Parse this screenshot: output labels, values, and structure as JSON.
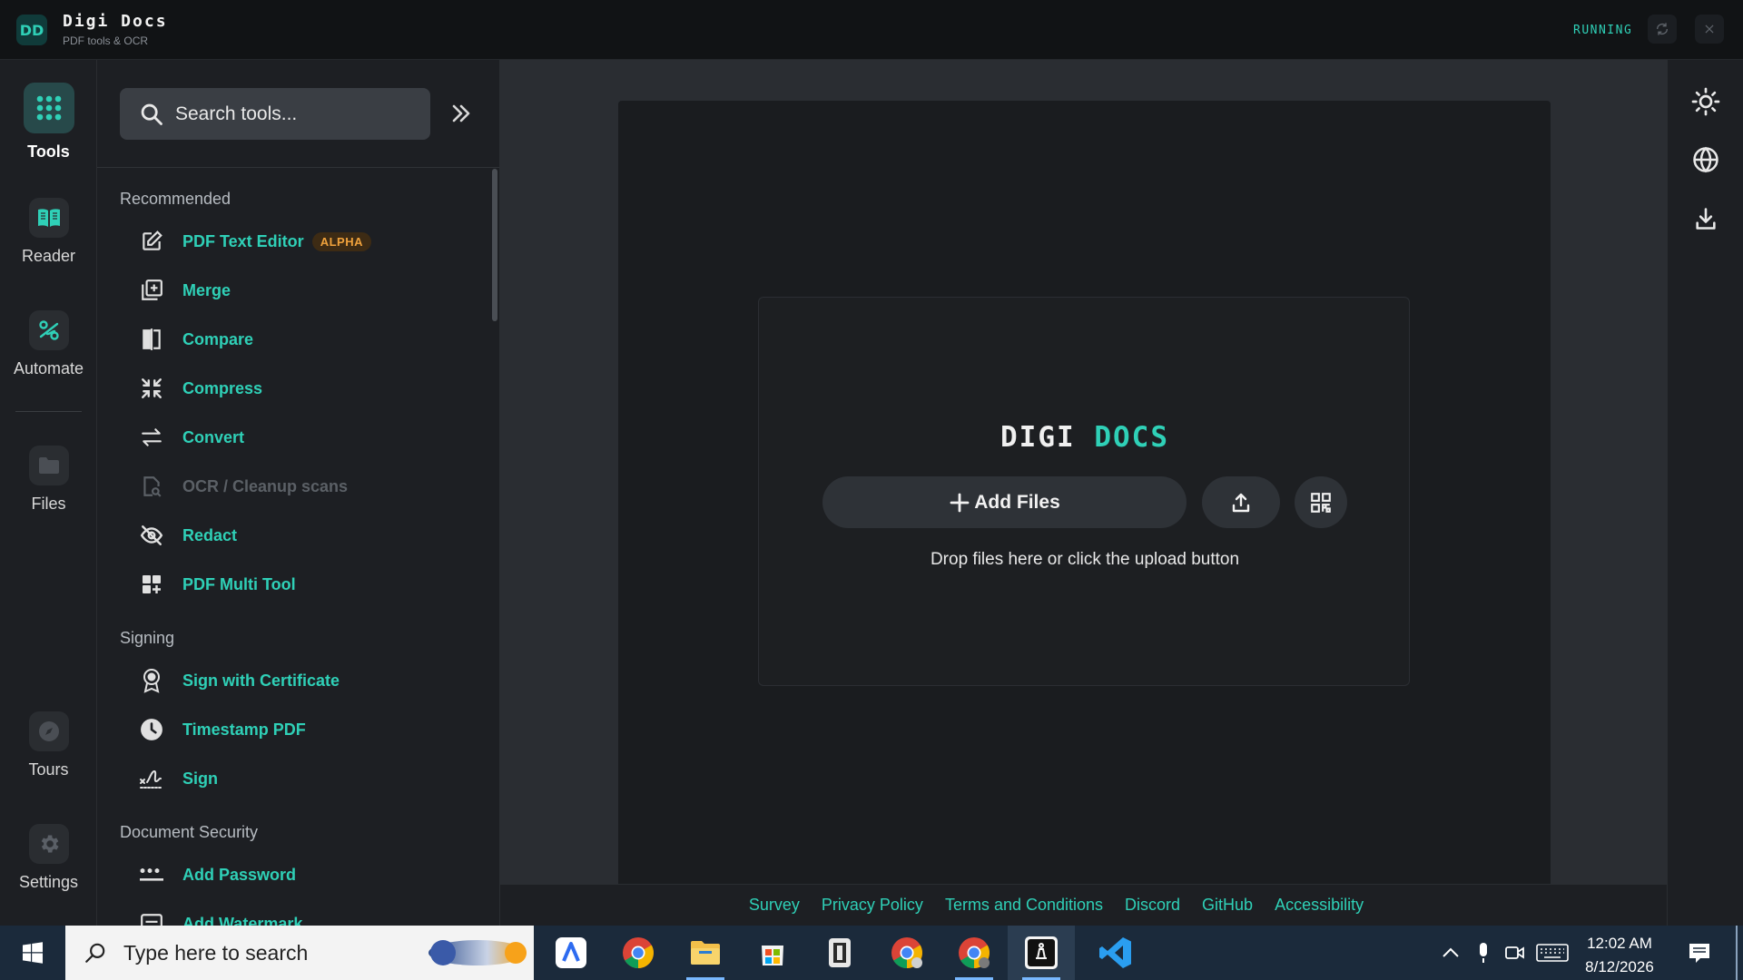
{
  "app": {
    "logo": "DD",
    "name": "Digi Docs",
    "subtitle": "PDF tools & OCR",
    "status": "RUNNING"
  },
  "rail": {
    "items": [
      {
        "label": "Tools",
        "icon": "grid-icon"
      },
      {
        "label": "Reader",
        "icon": "book-icon"
      },
      {
        "label": "Automate",
        "icon": "automate-icon"
      },
      {
        "label": "Files",
        "icon": "folder-icon"
      },
      {
        "label": "Tours",
        "icon": "compass-icon"
      },
      {
        "label": "Settings",
        "icon": "gear-icon"
      }
    ]
  },
  "tools_panel": {
    "search_placeholder": "Search tools...",
    "sections": [
      {
        "title": "Recommended",
        "items": [
          {
            "label": "PDF Text Editor",
            "badge": "ALPHA",
            "icon": "edit-icon"
          },
          {
            "label": "Merge",
            "icon": "merge-icon"
          },
          {
            "label": "Compare",
            "icon": "compare-icon"
          },
          {
            "label": "Compress",
            "icon": "compress-icon"
          },
          {
            "label": "Convert",
            "icon": "convert-icon"
          },
          {
            "label": "OCR / Cleanup scans",
            "icon": "ocr-icon",
            "disabled": true
          },
          {
            "label": "Redact",
            "icon": "eye-off-icon"
          },
          {
            "label": "PDF Multi Tool",
            "icon": "multi-tool-icon"
          }
        ]
      },
      {
        "title": "Signing",
        "items": [
          {
            "label": "Sign with Certificate",
            "icon": "certificate-icon"
          },
          {
            "label": "Timestamp PDF",
            "icon": "clock-icon"
          },
          {
            "label": "Sign",
            "icon": "signature-icon"
          }
        ]
      },
      {
        "title": "Document Security",
        "items": [
          {
            "label": "Add Password",
            "icon": "password-icon"
          },
          {
            "label": "Add Watermark",
            "icon": "watermark-icon"
          }
        ]
      }
    ]
  },
  "main": {
    "brand_part1": "DIGI",
    "brand_part2": "DOCS",
    "add_files": "Add Files",
    "drop_hint": "Drop files here or click the upload button"
  },
  "footer": {
    "links": [
      "Survey",
      "Privacy Policy",
      "Terms and Conditions",
      "Discord",
      "GitHub",
      "Accessibility"
    ]
  },
  "taskbar": {
    "search_placeholder": "Type here to search",
    "time": "12:02 AM",
    "date": "8/12/2026"
  },
  "colors": {
    "accent": "#2fd0b7",
    "badge": "#f0a23c",
    "background": "#1a1c20"
  }
}
